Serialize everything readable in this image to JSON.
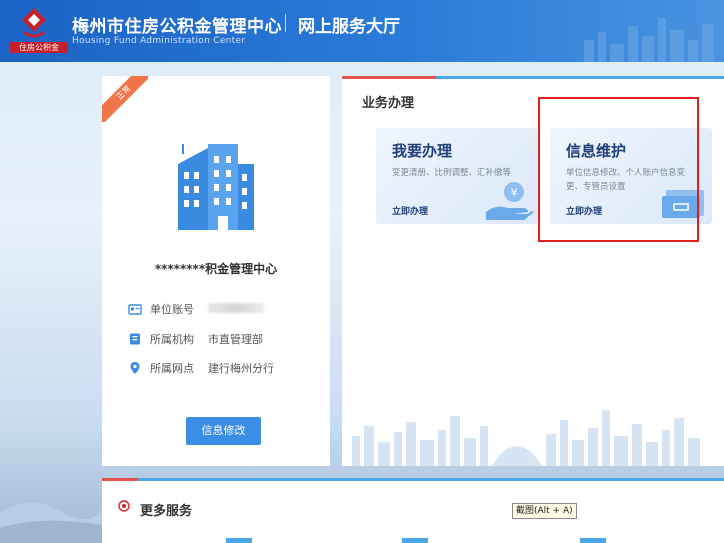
{
  "header": {
    "logo_text": "住房公积金",
    "title": "梅州市住房公积金管理中心",
    "subtitle": "网上服务大厅",
    "title_en": "Housing Fund Administration Center"
  },
  "left_card": {
    "ribbon": "正常",
    "org_name": "********积金管理中心",
    "info": [
      {
        "icon": "id-card-icon",
        "label": "单位账号",
        "value": ""
      },
      {
        "icon": "org-icon",
        "label": "所属机构",
        "value": "市直管理部"
      },
      {
        "icon": "location-pin-icon",
        "label": "所属网点",
        "value": "建行梅州分行"
      }
    ],
    "edit_button": "信息修改"
  },
  "business": {
    "section_title": "业务办理",
    "cards": [
      {
        "title": "我要办理",
        "desc": "变更清册、比例调整、汇补缴等",
        "link": "立即办理",
        "icon": "coin-hand-icon"
      },
      {
        "title": "信息维护",
        "desc": "单位信息修改、个人账户信息变更、专管员设置",
        "link": "立即办理",
        "icon": "folder-icon"
      }
    ]
  },
  "more": {
    "title": "更多服务"
  },
  "tooltip": "截图(Alt + A)",
  "colors": {
    "header": "#1b63c6",
    "accent": "#3b8ee6",
    "red": "#e0201c"
  }
}
